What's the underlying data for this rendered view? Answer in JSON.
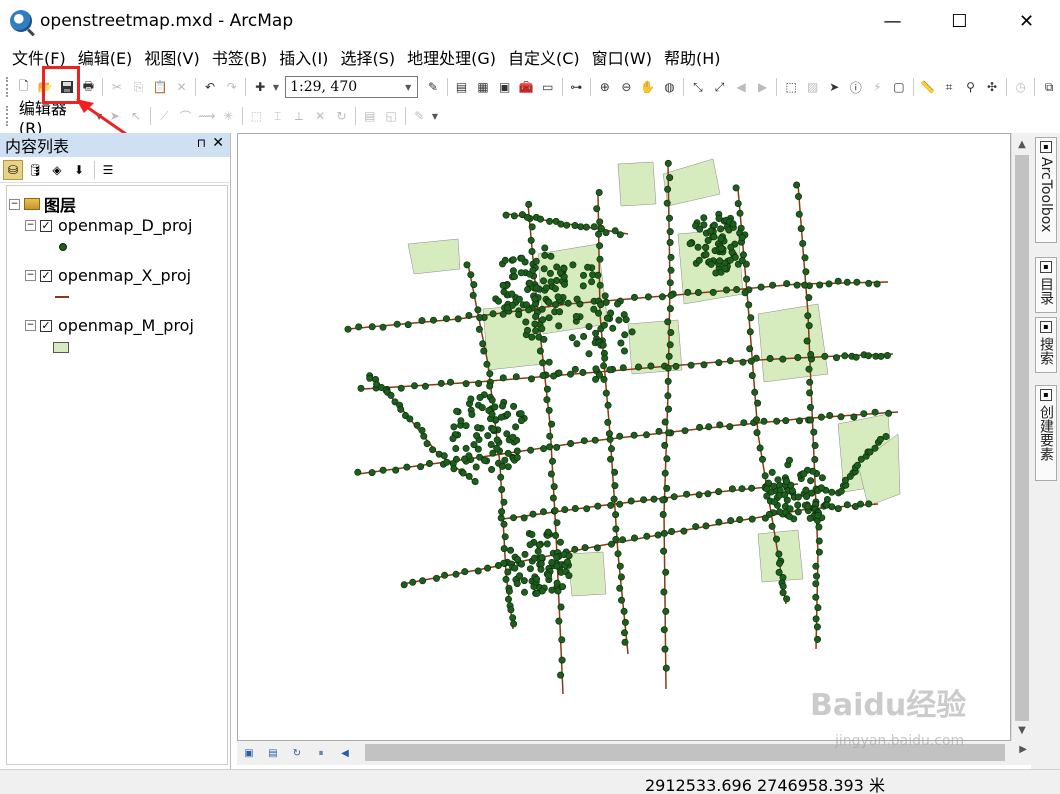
{
  "window": {
    "title": "openstreetmap.mxd - ArcMap",
    "minimize_symbol": "—",
    "maximize_symbol": "☐",
    "close_symbol": "✕"
  },
  "menu": [
    "文件(F)",
    "编辑(E)",
    "视图(V)",
    "书签(B)",
    "插入(I)",
    "选择(S)",
    "地理处理(G)",
    "自定义(C)",
    "窗口(W)",
    "帮助(H)"
  ],
  "toolbar": {
    "scale": "1:29, 470",
    "editor_label": "编辑器(R)"
  },
  "toc": {
    "title": "内容列表",
    "pin_symbol": "⊓",
    "close_symbol": "✕",
    "group_label": "图层",
    "layers": [
      {
        "name": "openmap_D_proj",
        "symbol": "point",
        "checked": true
      },
      {
        "name": "openmap_X_proj",
        "symbol": "line",
        "checked": true
      },
      {
        "name": "openmap_M_proj",
        "symbol": "polygon",
        "checked": true
      }
    ]
  },
  "side_tabs": [
    "ArcToolbox",
    "目录",
    "搜索",
    "创建要素"
  ],
  "status": {
    "coordinates": "2912533.696  2746958.393 米"
  },
  "watermark": {
    "brand": "Baidu经验",
    "url": "jingyan.baidu.com"
  },
  "colors": {
    "highlight": "#ee2222",
    "polygon_fill": "#d7ecbe",
    "road": "#8a3a16",
    "point": "#1d5e1d"
  },
  "map": {
    "overlay_seed": 7
  }
}
